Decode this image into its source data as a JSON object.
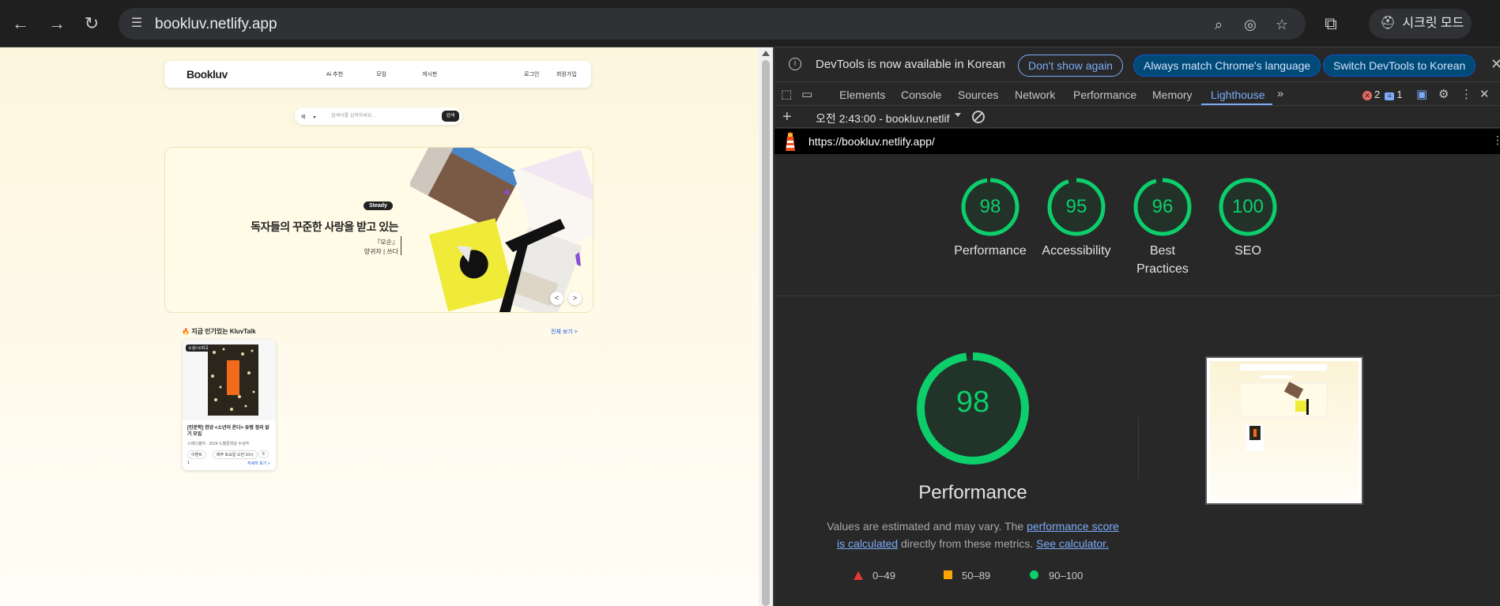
{
  "browser": {
    "url": "bookluv.netlify.app",
    "incognito_label": "시크릿 모드"
  },
  "site": {
    "logo": "Bookluv",
    "nav": [
      "Ai 추천",
      "모임",
      "게시판"
    ],
    "auth": [
      "로그인",
      "회원가입"
    ],
    "search": {
      "select": "제",
      "placeholder": "검색어를 입력하세요...",
      "button": "검색"
    },
    "banner": {
      "badge": "Steady",
      "headline": "독자들의 꾸준한 사랑을 받고 있는",
      "book_title": "『모순』",
      "author": "양귀자 | 쓰다",
      "prev": "<",
      "next": ">"
    },
    "talk": {
      "title": "지금 인기있는 KluvTalk",
      "more": "전체 보기 >",
      "card": {
        "tag": "소설/시/희곡",
        "title": "[인문학] 한강 <소년이 온다> 유령 정리 읽기 모임",
        "meta": "스테디셀러 · 2024 노벨문학상 수상작",
        "chips": [
          "이벤트",
          "매주 토요일 오전 10시",
          "6"
        ],
        "count": "1",
        "more": "자세히 보기 >"
      }
    }
  },
  "devtools": {
    "info_message": "DevTools is now available in Korean",
    "buttons": [
      "Don't show again",
      "Always match Chrome's language",
      "Switch DevTools to Korean"
    ],
    "tabs": [
      "Elements",
      "Console",
      "Sources",
      "Network",
      "Performance",
      "Memory",
      "Lighthouse"
    ],
    "active_tab": "Lighthouse",
    "errors": "2",
    "messages": "1",
    "report_label": "오전 2:43:00 - bookluv.netlif",
    "report_url": "https://bookluv.netlify.app/",
    "scores": [
      {
        "label": "Performance",
        "value": 98
      },
      {
        "label": "Accessibility",
        "value": 95
      },
      {
        "label": "Best Practices",
        "value": 96
      },
      {
        "label": "SEO",
        "value": 100
      }
    ],
    "performance": {
      "value": 98,
      "title": "Performance",
      "desc_prefix": "Values are estimated and may vary. The ",
      "desc_link1": "performance score is calculated",
      "desc_mid": " directly from these metrics. ",
      "desc_link2": "See calculator."
    },
    "legend": [
      "0–49",
      "50–89",
      "90–100"
    ],
    "colors": {
      "pass": "#0cce6b",
      "average": "#ffa400",
      "fail": "#e53935",
      "accent": "#7cacf8"
    }
  }
}
